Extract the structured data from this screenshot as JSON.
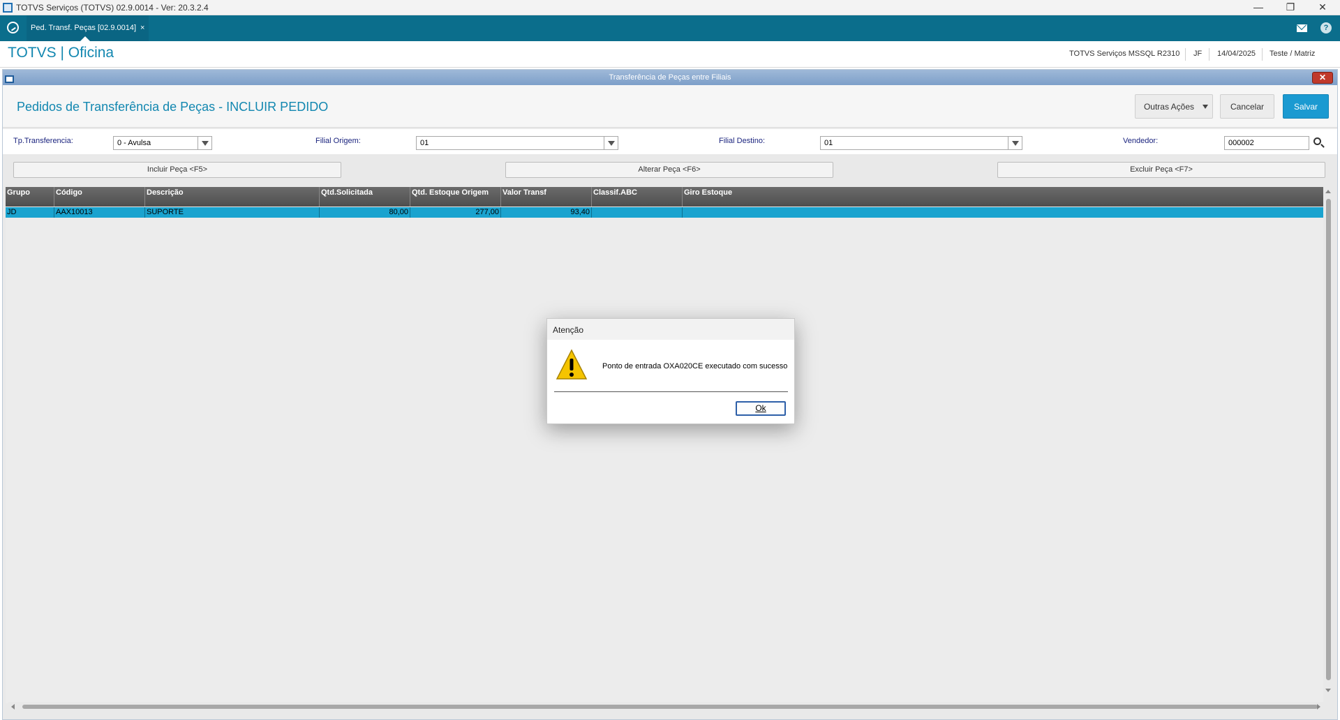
{
  "os_window": {
    "title": "TOTVS Serviços (TOTVS) 02.9.0014 - Ver: 20.3.2.4",
    "minimize_glyph": "—",
    "restore_glyph": "❐",
    "close_glyph": "✕"
  },
  "tabbar": {
    "tab_label": "Ped. Transf. Peças [02.9.0014]",
    "tab_close": "×",
    "help_glyph": "?"
  },
  "header": {
    "brand": "TOTVS | Oficina",
    "environment": "TOTVS Serviços MSSQL R2310",
    "user": "JF",
    "date": "14/04/2025",
    "branch": "Teste / Matriz"
  },
  "window": {
    "caption": "Transferência de Peças entre Filiais",
    "close_glyph": "✕"
  },
  "page": {
    "title": "Pedidos de Transferência de Peças - INCLUIR PEDIDO",
    "other_actions_label": "Outras Ações",
    "cancel_label": "Cancelar",
    "save_label": "Salvar"
  },
  "form": {
    "tp_transferencia_label": "Tp.Transferencia:",
    "tp_transferencia_value": "0 - Avulsa",
    "filial_origem_label": "Filial Origem:",
    "filial_origem_value": "01",
    "filial_destino_label": "Filial Destino:",
    "filial_destino_value": "01",
    "vendedor_label": "Vendedor:",
    "vendedor_value": "000002"
  },
  "actions": {
    "incluir": "Incluir Peça <F5>",
    "alterar": "Alterar Peça <F6>",
    "excluir": "Excluir Peça <F7>"
  },
  "grid": {
    "columns": [
      "Grupo",
      "Código",
      "Descrição",
      "Qtd.Solicitada",
      "Qtd. Estoque Origem",
      "Valor Transf",
      "Classif.ABC",
      "Giro Estoque"
    ],
    "rows": [
      [
        "JD",
        "AAX10013",
        "SUPORTE",
        "80,00",
        "277,00",
        "93,40",
        "",
        ""
      ]
    ],
    "selected_row_color": "#1aa3cf"
  },
  "dialog": {
    "title": "Atenção",
    "message": "Ponto de entrada OXA020CE executado com sucesso",
    "ok_label": "Ok",
    "icon": "warning-icon"
  },
  "colors": {
    "brand_teal": "#0b6e8c",
    "title_blue": "#1287b0",
    "save_blue": "#1b9ad1"
  }
}
